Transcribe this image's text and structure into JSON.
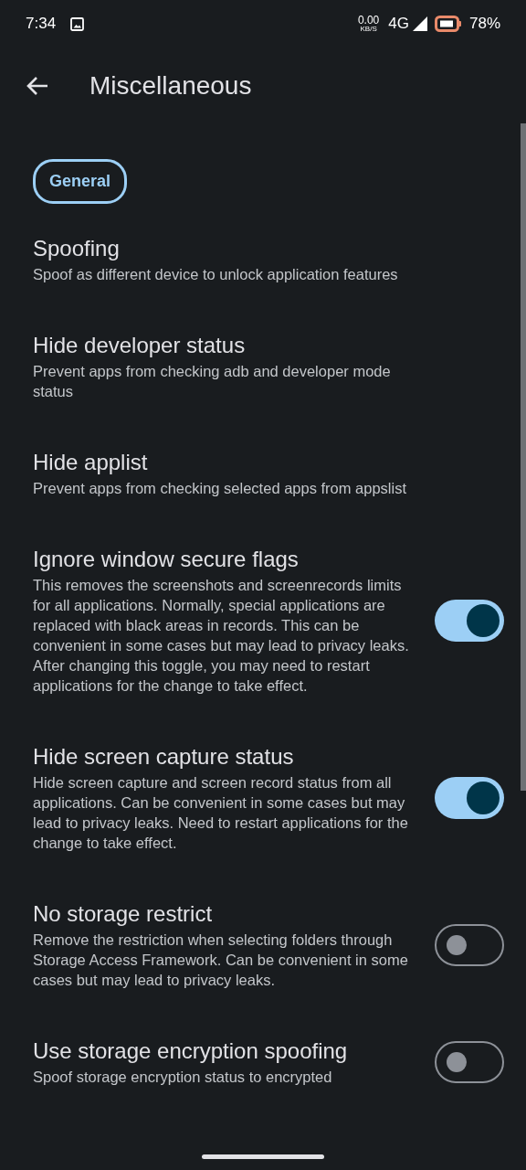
{
  "status_bar": {
    "time": "7:34",
    "net_speed": "0.00",
    "net_unit": "KB/S",
    "network": "4G",
    "battery": "78%"
  },
  "header": {
    "title": "Miscellaneous"
  },
  "section": {
    "label": "General"
  },
  "items": [
    {
      "kind": "link",
      "title": "Spoofing",
      "subtitle": "Spoof as different device to unlock application features"
    },
    {
      "kind": "link",
      "title": "Hide developer status",
      "subtitle": "Prevent apps from checking adb and developer mode status"
    },
    {
      "kind": "link",
      "title": "Hide applist",
      "subtitle": "Prevent apps from checking selected apps from appslist"
    },
    {
      "kind": "switch",
      "title": "Ignore window secure flags",
      "subtitle": "This removes the screenshots and screenrecords limits for all applications. Normally, special applications are replaced with black areas in records. This can be convenient in some cases but may lead to privacy leaks. After changing this toggle, you may need to restart applications for the change to take effect.",
      "on": true
    },
    {
      "kind": "switch",
      "title": "Hide screen capture status",
      "subtitle": "Hide screen capture and screen record status from all applications. Can be convenient in some cases but may lead to privacy leaks. Need to restart applications for the change to take effect.",
      "on": true
    },
    {
      "kind": "switch",
      "title": "No storage restrict",
      "subtitle": "Remove the restriction when selecting folders through Storage Access Framework. Can be convenient in some cases but may lead to privacy leaks.",
      "on": false
    },
    {
      "kind": "switch",
      "title": "Use storage encryption spoofing",
      "subtitle": "Spoof storage encryption status to encrypted",
      "on": false
    }
  ]
}
